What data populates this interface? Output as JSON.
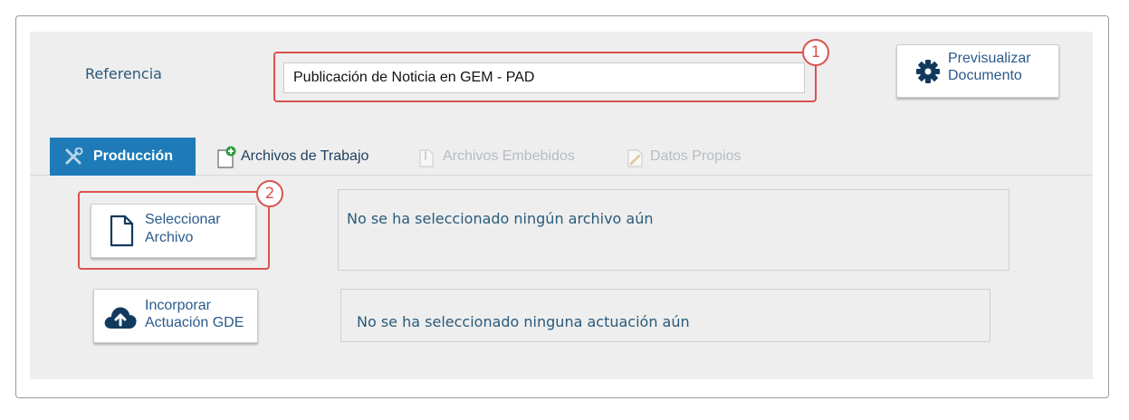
{
  "referencia": {
    "label": "Referencia",
    "value": "Publicación de Noticia en GEM - PAD"
  },
  "callouts": [
    "1",
    "2"
  ],
  "preview_button": {
    "line1": "Previsualizar",
    "line2": "Documento",
    "icon": "gear-icon"
  },
  "tabs": [
    {
      "label": "Producción",
      "icon": "tools-icon",
      "state": "active"
    },
    {
      "label": "Archivos de Trabajo",
      "icon": "document-add-icon",
      "state": "enabled"
    },
    {
      "label": "Archivos Embebidos",
      "icon": "attachment-icon",
      "state": "disabled"
    },
    {
      "label": "Datos Propios",
      "icon": "edit-document-icon",
      "state": "disabled"
    }
  ],
  "select_file_button": {
    "line1": "Seleccionar",
    "line2": "Archivo",
    "icon": "file-icon"
  },
  "select_file_message": "No se ha seleccionado ningún archivo aún",
  "incorporate_button": {
    "line1": "Incorporar",
    "line2": "Actuación GDE",
    "icon": "cloud-upload-icon"
  },
  "incorporate_message": "No se ha seleccionado ninguna actuación aún",
  "colors": {
    "accent_blue": "#1e7bb8",
    "callout_red": "#d9534f",
    "panel_gray": "#eeeeee",
    "icon_navy": "#123a5e"
  }
}
